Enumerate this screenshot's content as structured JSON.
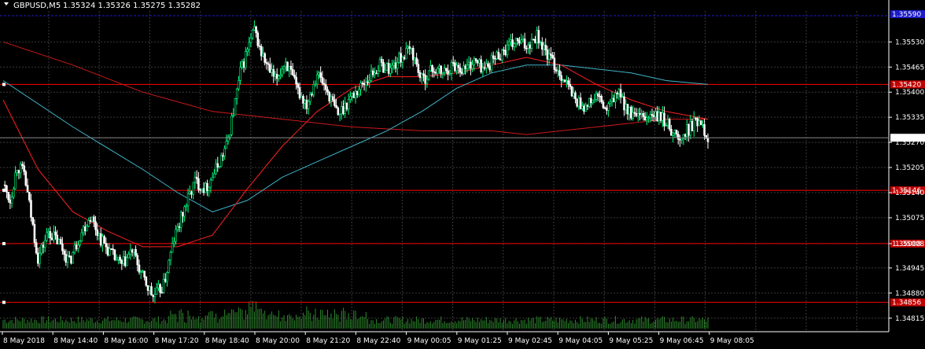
{
  "header": {
    "symbol": "GBPUSD,M5",
    "ohlc": "1.35324 1.35326 1.35275 1.35282"
  },
  "colors": {
    "background": "#000000",
    "grid": "#3a3a3a",
    "axis": "#ffffff",
    "bull_candle": "#00ff7f",
    "bear_candle": "#ffffff",
    "ma_fast": "#ff2020",
    "ma_slow_red": "#cc1a1a",
    "ma_slow_cyan": "#3fb4c8",
    "hline": "#ff0000",
    "bid_line": "#1c1cc8",
    "volume": "#2e8b2e",
    "price_label": "#c00000"
  },
  "chart_data": {
    "type": "candlestick",
    "symbol": "GBPUSD",
    "timeframe": "M5",
    "ylim": [
      1.3478,
      1.3561
    ],
    "price_ticks": [
      "1.35530",
      "1.35465",
      "1.35400",
      "1.35335",
      "1.35270",
      "1.35205",
      "1.35140",
      "1.35075",
      "1.35008",
      "1.34945",
      "1.34880",
      "1.34815"
    ],
    "x_labels": [
      "8 May 2018",
      "8 May 14:40",
      "8 May 16:00",
      "8 May 17:20",
      "8 May 18:40",
      "8 May 20:00",
      "8 May 21:20",
      "8 May 22:40",
      "9 May 00:05",
      "9 May 01:25",
      "9 May 02:45",
      "9 May 04:05",
      "9 May 05:25",
      "9 May 06:45",
      "9 May 08:05"
    ],
    "horizontal_levels": [
      {
        "price": 1.3542,
        "label": "1.35420"
      },
      {
        "price": 1.35146,
        "label": "1.35146"
      },
      {
        "price": 1.35008,
        "label": "1.35008"
      },
      {
        "price": 1.34856,
        "label": "1.34856"
      }
    ],
    "current_price": {
      "price": 1.35282,
      "label": "1.35282"
    },
    "top_label": "1.35590",
    "close_path": [
      [
        0,
        1.3516
      ],
      [
        4,
        1.3512
      ],
      [
        8,
        1.3521
      ],
      [
        12,
        1.3519
      ],
      [
        16,
        1.3508
      ],
      [
        20,
        1.3497
      ],
      [
        26,
        1.3504
      ],
      [
        32,
        1.3501
      ],
      [
        38,
        1.3496
      ],
      [
        44,
        1.3503
      ],
      [
        50,
        1.3508
      ],
      [
        56,
        1.3502
      ],
      [
        62,
        1.3498
      ],
      [
        68,
        1.3495
      ],
      [
        74,
        1.3499
      ],
      [
        80,
        1.3492
      ],
      [
        86,
        1.3487
      ],
      [
        92,
        1.349
      ],
      [
        98,
        1.3502
      ],
      [
        104,
        1.351
      ],
      [
        110,
        1.3517
      ],
      [
        116,
        1.3515
      ],
      [
        122,
        1.352
      ],
      [
        128,
        1.3526
      ],
      [
        132,
        1.3535
      ],
      [
        136,
        1.3545
      ],
      [
        140,
        1.3551
      ],
      [
        144,
        1.3556
      ],
      [
        148,
        1.355
      ],
      [
        152,
        1.3546
      ],
      [
        156,
        1.3543
      ],
      [
        162,
        1.3548
      ],
      [
        168,
        1.3541
      ],
      [
        174,
        1.3537
      ],
      [
        180,
        1.3545
      ],
      [
        186,
        1.354
      ],
      [
        192,
        1.3534
      ],
      [
        198,
        1.3538
      ],
      [
        204,
        1.3541
      ],
      [
        210,
        1.3544
      ],
      [
        216,
        1.3547
      ],
      [
        222,
        1.3546
      ],
      [
        228,
        1.3549
      ],
      [
        234,
        1.3551
      ],
      [
        240,
        1.3543
      ],
      [
        246,
        1.3546
      ],
      [
        252,
        1.3545
      ],
      [
        258,
        1.3547
      ],
      [
        264,
        1.3546
      ],
      [
        270,
        1.3548
      ],
      [
        276,
        1.3546
      ],
      [
        282,
        1.3549
      ],
      [
        288,
        1.3551
      ],
      [
        294,
        1.3553
      ],
      [
        300,
        1.3552
      ],
      [
        306,
        1.3555
      ],
      [
        310,
        1.3551
      ],
      [
        316,
        1.3547
      ],
      [
        322,
        1.3543
      ],
      [
        328,
        1.3538
      ],
      [
        334,
        1.3536
      ],
      [
        340,
        1.3539
      ],
      [
        346,
        1.3535
      ],
      [
        352,
        1.354
      ],
      [
        356,
        1.3537
      ],
      [
        360,
        1.3534
      ],
      [
        366,
        1.3533
      ],
      [
        372,
        1.3534
      ],
      [
        378,
        1.3533
      ],
      [
        384,
        1.353
      ],
      [
        388,
        1.3527
      ],
      [
        392,
        1.353
      ],
      [
        396,
        1.3532
      ],
      [
        400,
        1.3533
      ],
      [
        404,
        1.3528
      ]
    ],
    "ma_fast": [
      [
        0,
        1.3538
      ],
      [
        20,
        1.352
      ],
      [
        40,
        1.3509
      ],
      [
        60,
        1.3504
      ],
      [
        80,
        1.35
      ],
      [
        100,
        1.35
      ],
      [
        120,
        1.3503
      ],
      [
        140,
        1.3515
      ],
      [
        160,
        1.3526
      ],
      [
        180,
        1.3535
      ],
      [
        200,
        1.3541
      ],
      [
        220,
        1.3544
      ],
      [
        240,
        1.3544
      ],
      [
        260,
        1.3545
      ],
      [
        280,
        1.3547
      ],
      [
        300,
        1.3549
      ],
      [
        320,
        1.3547
      ],
      [
        340,
        1.3542
      ],
      [
        360,
        1.3538
      ],
      [
        380,
        1.3535
      ],
      [
        404,
        1.3533
      ]
    ],
    "ma_slow_red": [
      [
        0,
        1.3553
      ],
      [
        40,
        1.3547
      ],
      [
        80,
        1.354
      ],
      [
        120,
        1.3535
      ],
      [
        160,
        1.3533
      ],
      [
        200,
        1.3531
      ],
      [
        240,
        1.353
      ],
      [
        280,
        1.353
      ],
      [
        300,
        1.3529
      ],
      [
        320,
        1.353
      ],
      [
        360,
        1.3532
      ],
      [
        380,
        1.3533
      ],
      [
        404,
        1.3533
      ]
    ],
    "ma_slow_cyan": [
      [
        0,
        1.3543
      ],
      [
        40,
        1.3531
      ],
      [
        80,
        1.352
      ],
      [
        100,
        1.3514
      ],
      [
        120,
        1.3509
      ],
      [
        140,
        1.3512
      ],
      [
        160,
        1.3518
      ],
      [
        180,
        1.3522
      ],
      [
        200,
        1.3526
      ],
      [
        220,
        1.353
      ],
      [
        240,
        1.3535
      ],
      [
        260,
        1.3541
      ],
      [
        280,
        1.3545
      ],
      [
        300,
        1.3547
      ],
      [
        320,
        1.3547
      ],
      [
        340,
        1.3546
      ],
      [
        360,
        1.3545
      ],
      [
        380,
        1.3543
      ],
      [
        404,
        1.3542
      ]
    ]
  }
}
